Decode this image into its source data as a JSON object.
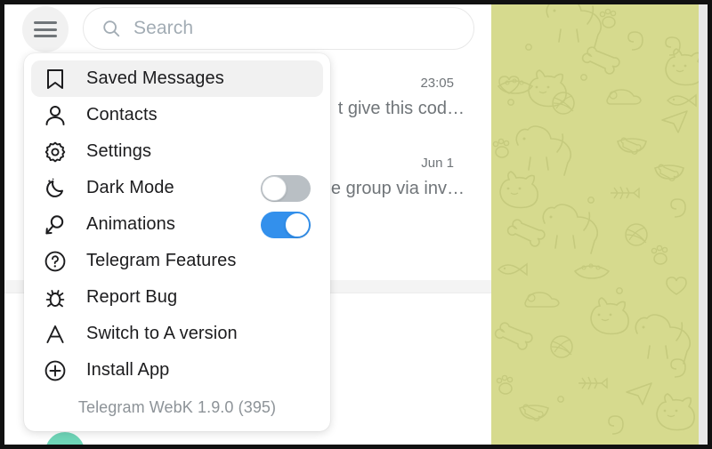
{
  "window": {
    "app_name": "Telegram WebK"
  },
  "topbar": {
    "hamburger_icon": "hamburger-menu-icon",
    "search": {
      "icon": "search-icon",
      "placeholder": "Search",
      "value": ""
    }
  },
  "menu": {
    "items": [
      {
        "label": "Saved Messages",
        "icon": "bookmark-icon",
        "active": true,
        "toggle": null
      },
      {
        "label": "Contacts",
        "icon": "person-icon",
        "active": false,
        "toggle": null
      },
      {
        "label": "Settings",
        "icon": "gear-icon",
        "active": false,
        "toggle": null
      },
      {
        "label": "Dark Mode",
        "icon": "moon-icon",
        "active": false,
        "toggle": "off"
      },
      {
        "label": "Animations",
        "icon": "magic-wand-icon",
        "active": false,
        "toggle": "on"
      },
      {
        "label": "Telegram Features",
        "icon": "question-mark-icon",
        "active": false,
        "toggle": null
      },
      {
        "label": "Report Bug",
        "icon": "bug-icon",
        "active": false,
        "toggle": null
      },
      {
        "label": "Switch to A version",
        "icon": "letter-a-icon",
        "active": false,
        "toggle": null
      },
      {
        "label": "Install App",
        "icon": "plus-circle-icon",
        "active": false,
        "toggle": null
      }
    ],
    "version": "Telegram WebK 1.9.0 (395)"
  },
  "chat_list": {
    "rows": [
      {
        "time": "23:05",
        "preview": "t give this cod…"
      },
      {
        "time": "Jun 1",
        "preview": "e group via inv…"
      }
    ]
  },
  "chat_area": {
    "wallpaper": "pet-doodle-pattern",
    "background_color": "#d6da8e",
    "doodle_color": "#c2c77c"
  },
  "colors": {
    "accent": "#3390ec",
    "toggle_off": "#b9bfc4",
    "text_primary": "#1c1c1e",
    "text_secondary": "#707579",
    "hover": "#f1f1f1"
  }
}
